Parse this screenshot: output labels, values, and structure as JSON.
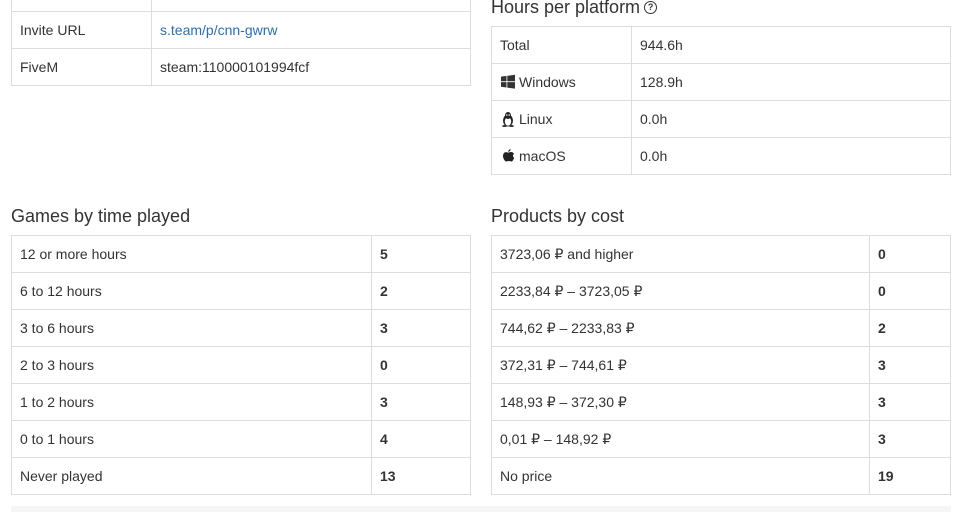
{
  "profile": {
    "rows": [
      {
        "label": "Invite URL",
        "value": "s.team/p/cnn-gwrw"
      },
      {
        "label": "FiveM",
        "value": "steam:110000101994fcf"
      }
    ]
  },
  "platforms": {
    "title": "Hours per platform",
    "help": "?",
    "rows": [
      {
        "label": "Total",
        "value": "944.6h",
        "icon": ""
      },
      {
        "label": "Windows",
        "value": "128.9h",
        "icon": "windows-icon"
      },
      {
        "label": "Linux",
        "value": "0.0h",
        "icon": "linux-icon"
      },
      {
        "label": "macOS",
        "value": "0.0h",
        "icon": "apple-icon"
      }
    ]
  },
  "games": {
    "title": "Games by time played",
    "rows": [
      {
        "label": "12 or more hours",
        "value": "5"
      },
      {
        "label": "6 to 12 hours",
        "value": "2"
      },
      {
        "label": "3 to 6 hours",
        "value": "3"
      },
      {
        "label": "2 to 3 hours",
        "value": "0"
      },
      {
        "label": "1 to 2 hours",
        "value": "3"
      },
      {
        "label": "0 to 1 hours",
        "value": "4"
      },
      {
        "label": "Never played",
        "value": "13"
      }
    ]
  },
  "products": {
    "title": "Products by cost",
    "rows": [
      {
        "label": "3723,06 ₽ and higher",
        "value": "0"
      },
      {
        "label": "2233,84 ₽ – 3723,05 ₽",
        "value": "0"
      },
      {
        "label": "744,62 ₽ – 2233,83 ₽",
        "value": "2"
      },
      {
        "label": "372,31 ₽ – 744,61 ₽",
        "value": "3"
      },
      {
        "label": "148,93 ₽ – 372,30 ₽",
        "value": "3"
      },
      {
        "label": "0,01 ₽ – 148,92 ₽",
        "value": "3"
      },
      {
        "label": "No price",
        "value": "19"
      }
    ]
  }
}
